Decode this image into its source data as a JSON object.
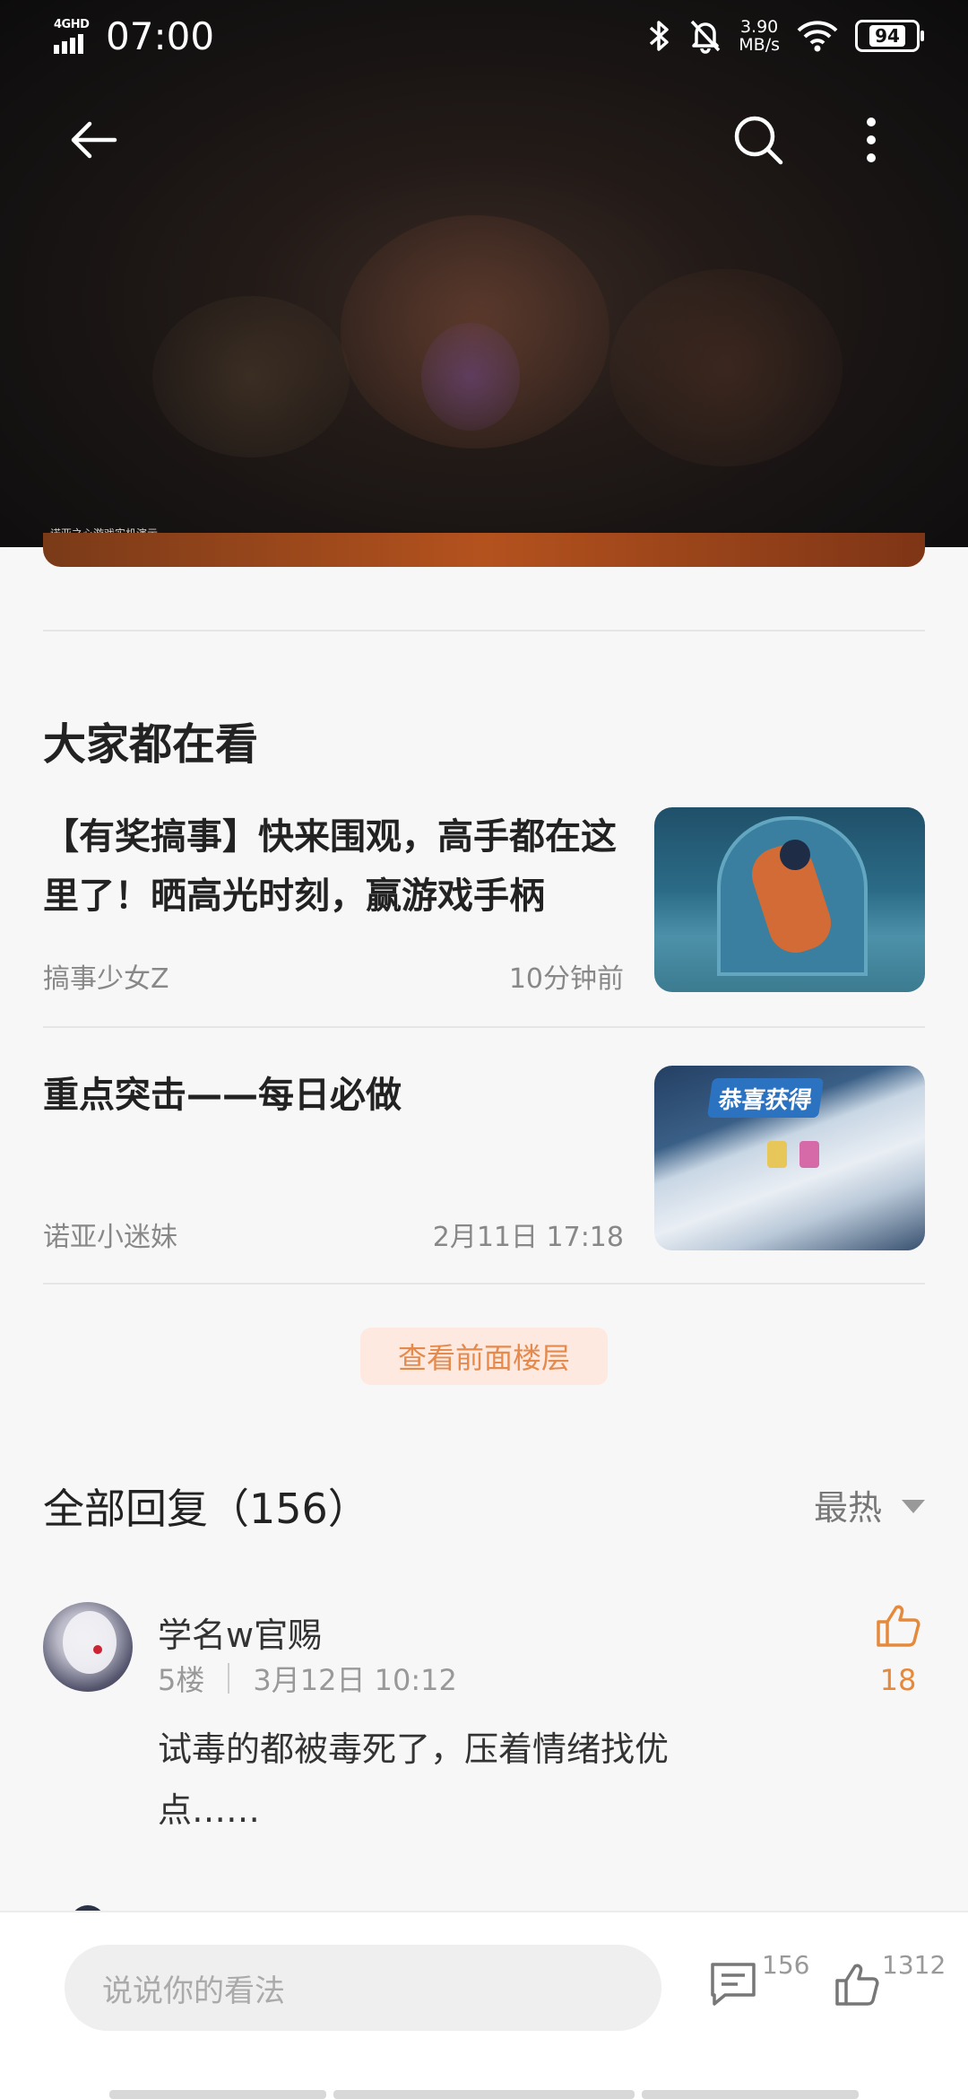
{
  "status_bar": {
    "network": "4GHD",
    "time": "07:00",
    "speed_value": "3.90",
    "speed_unit": "MB/s",
    "battery": "94"
  },
  "toolbar": {
    "back_icon": "arrow-left-icon",
    "search_icon": "search-icon",
    "more_icon": "more-vertical-icon"
  },
  "hero": {
    "caption": "诺亚之心游戏实机演示"
  },
  "recommend": {
    "title": "大家都在看",
    "articles": [
      {
        "title": "【有奖搞事】快来围观，高手都在这里了！晒高光时刻，赢游戏手柄",
        "author": "搞事少女Z",
        "time": "10分钟前"
      },
      {
        "title": "重点突击——每日必做",
        "author": "诺亚小迷妹",
        "time": "2月11日 17:18",
        "thumb_banner": "恭喜获得"
      }
    ]
  },
  "view_prev_label": "查看前面楼层",
  "replies": {
    "header": "全部回复（156）",
    "sort_label": "最热",
    "items": [
      {
        "name": "学名w官赐",
        "floor": "5楼",
        "time": "3月12日 10:12",
        "text": "试毒的都被毒死了，压着情绪找优点……",
        "likes": "18"
      }
    ]
  },
  "bottom_bar": {
    "input_placeholder": "说说你的看法",
    "comment_count": "156",
    "like_count": "1312"
  },
  "colors": {
    "accent": "#e58a3c",
    "accent_bg": "#fde9e0"
  }
}
